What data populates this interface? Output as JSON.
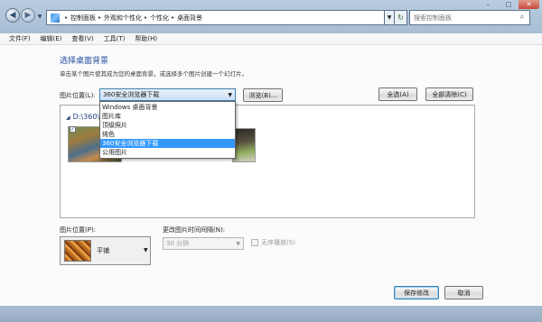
{
  "window": {
    "breadcrumb": [
      "控制面板",
      "外观和个性化",
      "个性化",
      "桌面背景"
    ],
    "search_placeholder": "搜索控制面板",
    "controls": {
      "minimize": "–",
      "maximize": "□",
      "close": "✕"
    }
  },
  "menu": [
    "文件(F)",
    "编辑(E)",
    "查看(V)",
    "工具(T)",
    "帮助(H)"
  ],
  "page": {
    "title": "选择桌面背景",
    "description": "单击某个图片使其成为您的桌面背景，或选择多个图片创建一个幻灯片。"
  },
  "picture_location": {
    "label": "图片位置(L):",
    "selected": "360安全浏览器下载",
    "options": [
      "Windows 桌面背景",
      "图片库",
      "顶级照片",
      "纯色",
      "360安全浏览器下载",
      "公用图片"
    ],
    "highlighted_index": 4
  },
  "buttons": {
    "browse": "浏览(B)...",
    "select_all": "全选(A)",
    "clear_all": "全部清除(C)",
    "save": "保存修改",
    "cancel": "取消"
  },
  "gallery": {
    "group_label": "D:\\360\\"
  },
  "picture_position": {
    "label": "图片位置(P):",
    "value": "平铺"
  },
  "interval": {
    "label": "更改图片时间间隔(N):",
    "value": "30 分钟"
  },
  "shuffle": {
    "label": "无序播放(S)",
    "checked": false
  },
  "icons": {
    "back": "back-arrow-icon",
    "forward": "forward-arrow-icon",
    "refresh": "refresh-icon",
    "search": "search-icon"
  }
}
